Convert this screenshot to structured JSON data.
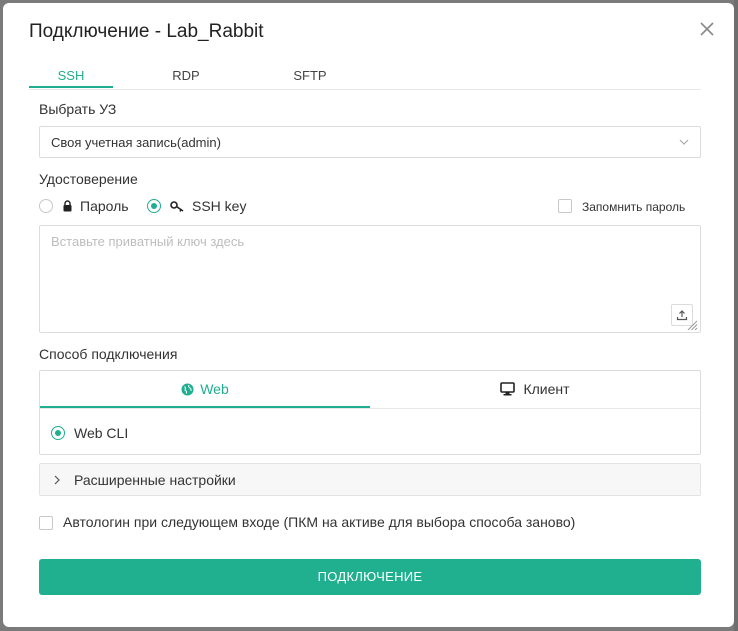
{
  "dialog": {
    "title": "Подключение - Lab_Rabbit",
    "close_icon": "close-icon"
  },
  "tabs": [
    {
      "label": "SSH",
      "active": true
    },
    {
      "label": "RDP",
      "active": false
    },
    {
      "label": "SFTP",
      "active": false
    }
  ],
  "account": {
    "label": "Выбрать УЗ",
    "value": "Своя учетная запись(admin)"
  },
  "credential": {
    "label": "Удостоверение",
    "options": [
      {
        "label": "Пароль",
        "icon": "lock-icon",
        "selected": false
      },
      {
        "label": "SSH key",
        "icon": "key-icon",
        "selected": true
      }
    ],
    "remember_label": "Запомнить пароль",
    "remember_checked": false
  },
  "key_input": {
    "placeholder": "Вставьте приватный ключ здесь",
    "upload_icon": "upload-icon"
  },
  "connection": {
    "label": "Способ подключения",
    "tabs": [
      {
        "label": "Web",
        "icon": "globe-icon",
        "active": true
      },
      {
        "label": "Клиент",
        "icon": "monitor-icon",
        "active": false
      }
    ],
    "option": {
      "label": "Web CLI",
      "selected": true
    }
  },
  "advanced": {
    "label": "Расширенные настройки"
  },
  "autologin": {
    "label": "Автологин при следующем входе (ПКМ на активе для выбора способа заново)",
    "checked": false
  },
  "submit": {
    "label": "ПОДКЛЮЧЕНИЕ"
  },
  "colors": {
    "accent": "#1fae8f",
    "button": "#21b08f"
  }
}
